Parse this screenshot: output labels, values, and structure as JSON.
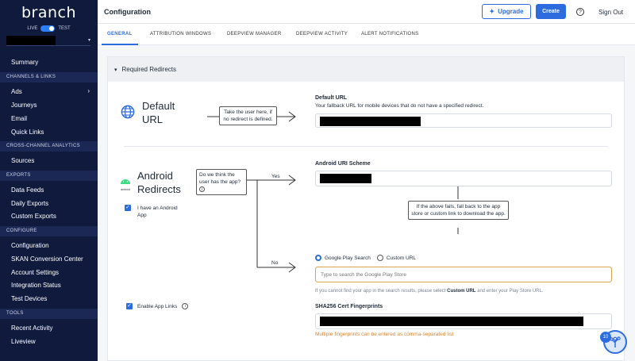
{
  "sidebar": {
    "brand": "branch",
    "env_live": "LIVE",
    "env_test": "TEST",
    "summary": "Summary",
    "sections": {
      "channels": "CHANNELS & LINKS",
      "cross": "CROSS-CHANNEL ANALYTICS",
      "exports": "EXPORTS",
      "configure": "CONFIGURE",
      "tools": "TOOLS"
    },
    "items": {
      "ads": "Ads",
      "journeys": "Journeys",
      "email": "Email",
      "quick_links": "Quick Links",
      "sources": "Sources",
      "data_feeds": "Data Feeds",
      "daily_exports": "Daily Exports",
      "custom_exports": "Custom Exports",
      "configuration": "Configuration",
      "skan": "SKAN Conversion Center",
      "account_settings": "Account Settings",
      "integration_status": "Integration Status",
      "test_devices": "Test Devices",
      "recent_activity": "Recent Activity",
      "liveview": "Liveview"
    }
  },
  "header": {
    "title": "Configuration",
    "upgrade": "Upgrade",
    "create": "Create",
    "help": "?",
    "sign_out": "Sign Out"
  },
  "tabs": [
    "GENERAL",
    "ATTRIBUTION WINDOWS",
    "DEEPVIEW MANAGER",
    "DEEPVIEW ACTIVITY",
    "ALERT NOTIFICATIONS"
  ],
  "section": {
    "title": "Required Redirects"
  },
  "default_url": {
    "title_line1": "Default",
    "title_line2": "URL",
    "bubble": "Take the user here, if no redirect is defined.",
    "label": "Default URL",
    "desc": "Your fallback URL for mobile devices that do not have a specified redirect."
  },
  "android": {
    "title_line1": "Android",
    "title_line2": "Redirects",
    "logo_text": "android",
    "question": "Do we think the user has the app?",
    "info": "i",
    "yes": "Yes",
    "no": "No",
    "have_app": "I have an Android App",
    "uri_label": "Android URI Scheme",
    "fallback_bubble": "If the above fails, fall back to the app store or custom link to download the app.",
    "radio_play": "Google Play Search",
    "radio_custom": "Custom URL",
    "search_placeholder": "Type to search the Google Play Store",
    "hint_pre": "If you cannot find your app in the search results, please select ",
    "hint_bold": "Custom URL",
    "hint_post": " and enter your Play Store URL.",
    "enable_app_links": "Enable App Links",
    "sha_label": "SHA256 Cert Fingerprints",
    "sha_note": "Multiple fingerprints can be entered as comma-separated list"
  },
  "notifications": {
    "count": "10"
  },
  "colors": {
    "accent": "#2d6cdf",
    "sidebar": "#0f1a3d",
    "warning": "#d9822b"
  }
}
